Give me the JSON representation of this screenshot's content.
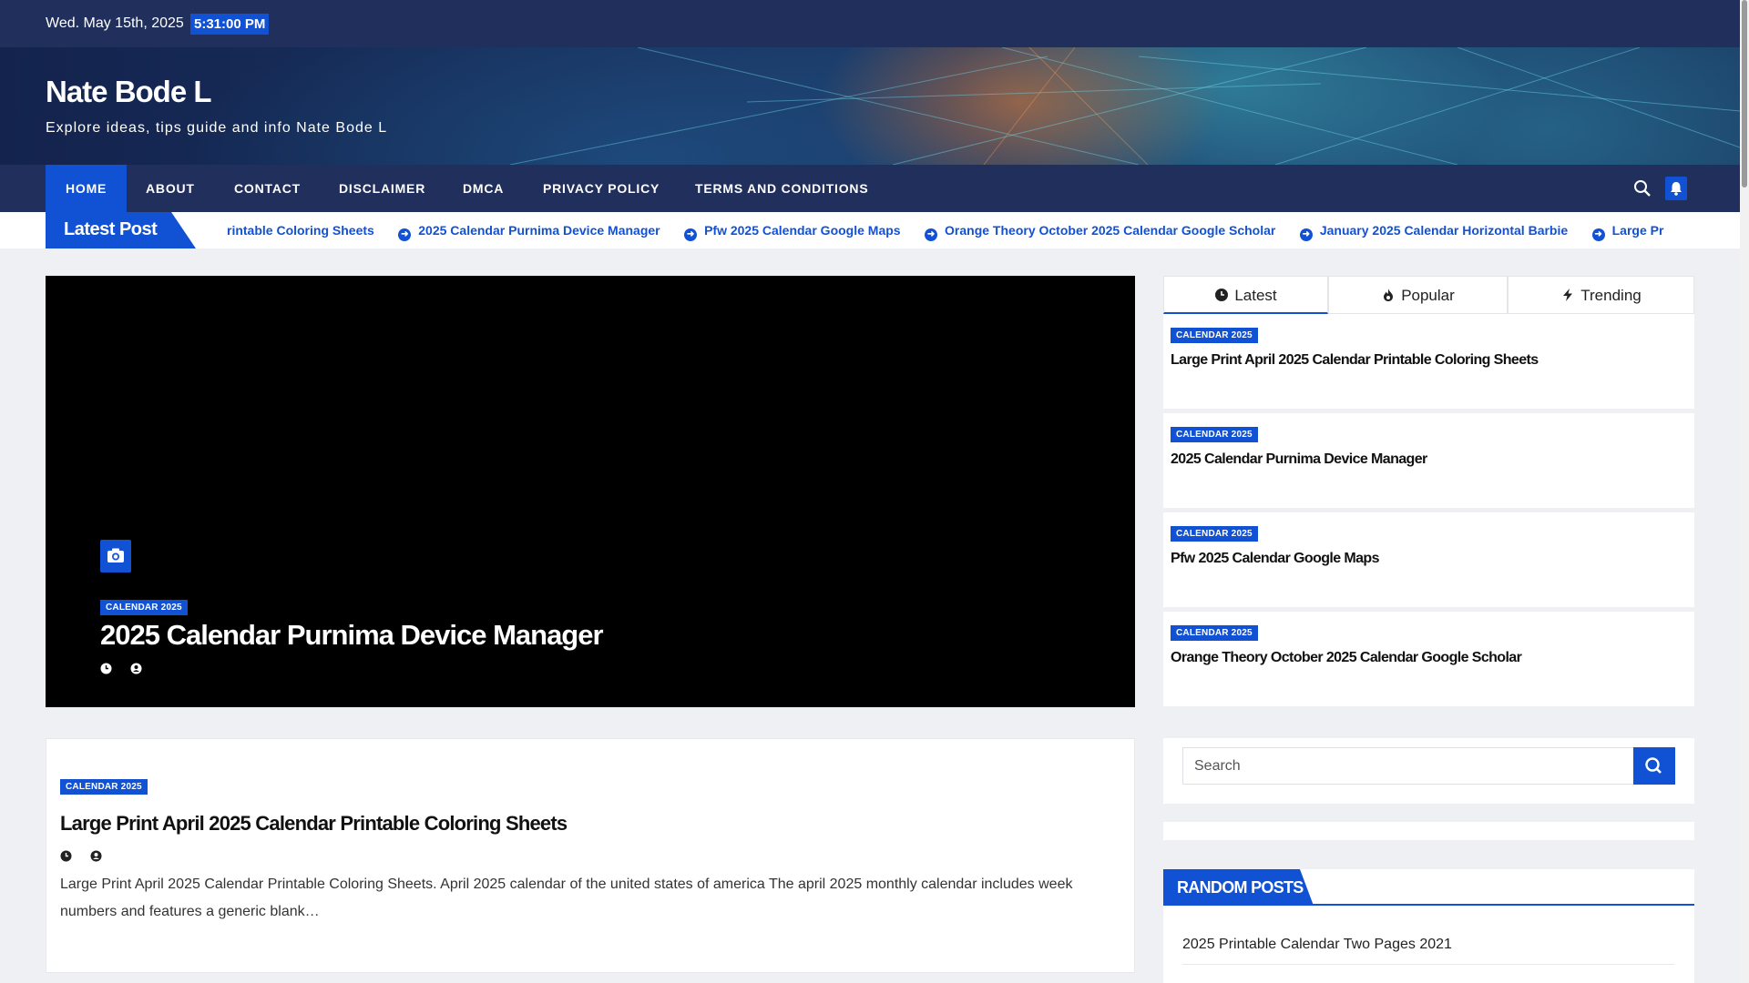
{
  "topbar": {
    "date": "Wed. May 15th, 2025",
    "time": "5:31:00 PM"
  },
  "site": {
    "title": "Nate Bode L",
    "description": "Explore ideas, tips guide and info Nate Bode L"
  },
  "nav": {
    "items": [
      {
        "label": "HOME"
      },
      {
        "label": "ABOUT"
      },
      {
        "label": "CONTACT"
      },
      {
        "label": "DISCLAIMER"
      },
      {
        "label": "DMCA"
      },
      {
        "label": "PRIVACY POLICY"
      },
      {
        "label": "TERMS AND CONDITIONS"
      }
    ],
    "active": "HOME"
  },
  "ticker": {
    "label": "Latest Post",
    "items": [
      "rintable Coloring Sheets",
      "2025 Calendar Purnima Device Manager",
      "Pfw 2025 Calendar Google Maps",
      "Orange Theory October 2025 Calendar Google Scholar",
      "January 2025 Calendar Horizontal Barbie",
      "Large Pr"
    ]
  },
  "featured": {
    "category": "CALENDAR 2025",
    "title": "2025 Calendar Purnima Device Manager"
  },
  "tabs": [
    {
      "label": "Latest",
      "icon": "clock-icon"
    },
    {
      "label": "Popular",
      "icon": "fire-icon"
    },
    {
      "label": "Trending",
      "icon": "bolt-icon"
    }
  ],
  "side_posts": [
    {
      "category": "CALENDAR 2025",
      "title": "Large Print April 2025 Calendar Printable Coloring Sheets"
    },
    {
      "category": "CALENDAR 2025",
      "title": "2025 Calendar Purnima Device Manager"
    },
    {
      "category": "CALENDAR 2025",
      "title": "Pfw 2025 Calendar Google Maps"
    },
    {
      "category": "CALENDAR 2025",
      "title": "Orange Theory October 2025 Calendar Google Scholar"
    }
  ],
  "post": {
    "category": "CALENDAR 2025",
    "title": "Large Print April 2025 Calendar Printable Coloring Sheets",
    "excerpt": "Large Print April 2025 Calendar Printable Coloring Sheets. April 2025 calendar of the united states of america The april 2025 monthly calendar includes week numbers and features a generic blank…"
  },
  "search": {
    "placeholder": "Search"
  },
  "random_posts": {
    "label": "RANDOM POSTS",
    "items": [
      "2025 Printable Calendar Two Pages 2021"
    ]
  },
  "colors": {
    "accent": "#1151d3",
    "navy": "#202f5b"
  }
}
